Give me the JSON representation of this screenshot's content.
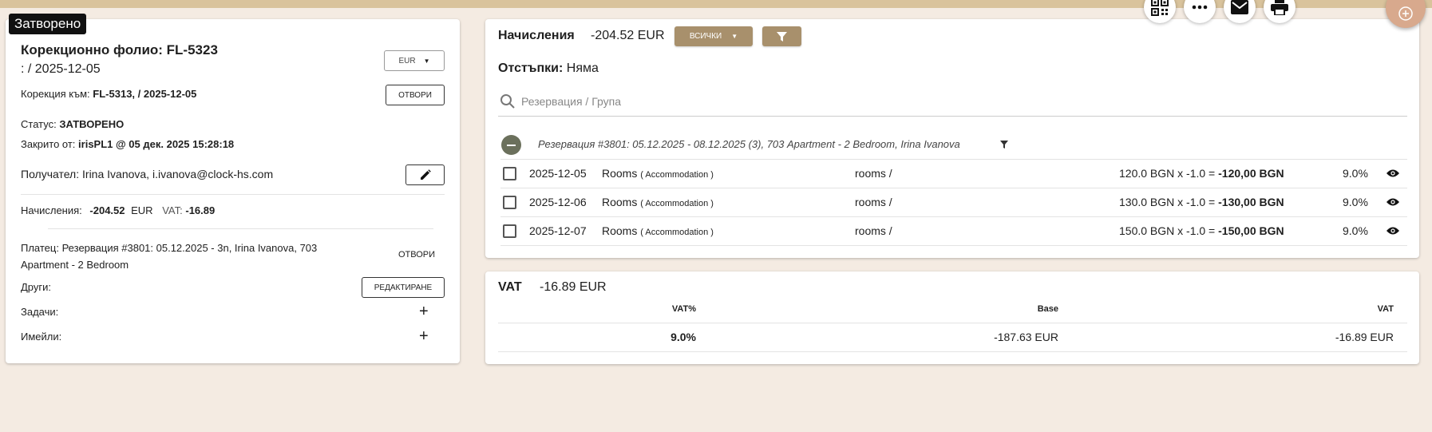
{
  "status_chip": "Затворено",
  "folio": {
    "title": "Корекционно фолио: FL-5323",
    "subtitle": ": / 2025-12-05",
    "currency": "EUR",
    "correction_label": "Корекция към:",
    "correction_value": "FL-5313, / 2025-12-05",
    "open_label": "ОТВОРИ",
    "status_label": "Статус:",
    "status_value": "ЗАТВОРЕНО",
    "closed_by_label": "Закрито от:",
    "closed_by_value": "irisPL1 @ 05 дек. 2025 15:28:18",
    "recipient_label": "Получател:",
    "recipient_value": "Irina Ivanova, i.ivanova@clock-hs.com",
    "charges_label": "Начисления:",
    "charges_value": "-204.52",
    "charges_currency": "EUR",
    "vat_label": "VAT:",
    "vat_value": "-16.89",
    "payer_line1": "Платец: Резервация #3801: 05.12.2025 - 3n, Irina Ivanova, 703",
    "payer_line2": "Apartment - 2 Bedroom",
    "payer_open_label": "ОТВОРИ",
    "others_label": "Други:",
    "edit_label": "РЕДАКТИРАНЕ",
    "tasks_label": "Задачи:",
    "emails_label": "Имейли:"
  },
  "charges": {
    "title": "Начисления",
    "total": "-204.52 EUR",
    "filter_all_label": "ВСИЧКИ",
    "discounts_label": "Отстъпки:",
    "discounts_value": "Няма",
    "search_placeholder": "Резервация / Група",
    "group_label": "Резервация #3801: 05.12.2025 - 08.12.2025 (3), 703 Apartment - 2 Bedroom, Irina Ivanova",
    "rows": [
      {
        "date": "2025-12-05",
        "item": "Rooms",
        "category": "( Accommodation )",
        "dept": "rooms /",
        "calc": "120.0 BGN x -1.0 = ",
        "amount": "-120,00 BGN",
        "vat": "9.0%"
      },
      {
        "date": "2025-12-06",
        "item": "Rooms",
        "category": "( Accommodation )",
        "dept": "rooms /",
        "calc": "130.0 BGN x -1.0 = ",
        "amount": "-130,00 BGN",
        "vat": "9.0%"
      },
      {
        "date": "2025-12-07",
        "item": "Rooms",
        "category": "( Accommodation )",
        "dept": "rooms /",
        "calc": "150.0 BGN x -1.0 = ",
        "amount": "-150,00 BGN",
        "vat": "9.0%"
      }
    ]
  },
  "vat": {
    "title": "VAT",
    "total": "-16.89 EUR",
    "col_rate": "VAT%",
    "col_base": "Base",
    "col_vat": "VAT",
    "row_rate": "9.0%",
    "row_base": "-187.63 EUR",
    "row_vat": "-16.89 EUR"
  },
  "colors": {
    "accent_tan": "#a8906c",
    "top_bar": "#d9c39c",
    "background": "#f4ebe2",
    "fab_add": "#d8a98d",
    "collapse_btn": "#6b705c"
  }
}
